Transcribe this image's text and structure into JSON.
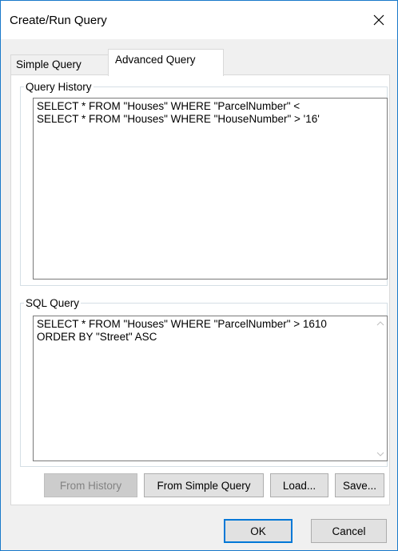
{
  "window": {
    "title": "Create/Run Query",
    "close_glyph": "✕"
  },
  "tabs": [
    {
      "label": "Simple Query",
      "selected": false
    },
    {
      "label": "Advanced Query",
      "selected": true
    }
  ],
  "query_history": {
    "label": "Query History",
    "items": [
      "SELECT * FROM \"Houses\" WHERE \"ParcelNumber\" <",
      "SELECT * FROM \"Houses\" WHERE \"HouseNumber\" > '16'"
    ]
  },
  "sql_query": {
    "label": "SQL Query",
    "value": "SELECT * FROM \"Houses\" WHERE \"ParcelNumber\" > 1610 ORDER BY \"Street\" ASC"
  },
  "buttons": {
    "from_history": "From History",
    "from_simple_query": "From Simple Query",
    "load": "Load...",
    "save": "Save...",
    "ok": "OK",
    "cancel": "Cancel"
  },
  "icons": {
    "close": "close-icon",
    "scroll_up": "chevron-up-icon",
    "scroll_down": "chevron-down-icon"
  },
  "colors": {
    "window_border": "#1979ca",
    "default_button_border": "#0078d7",
    "disabled_text": "#838383"
  }
}
